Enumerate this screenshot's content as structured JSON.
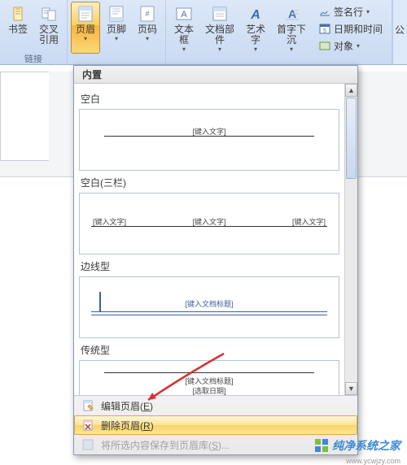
{
  "ribbon": {
    "groups": {
      "links": {
        "label": "链接",
        "items": {
          "bookmark": "书签",
          "crossref": "交叉\n引用"
        }
      },
      "headerfooter": {
        "items": {
          "header": "页眉",
          "footer": "页脚",
          "pagenum": "页码"
        }
      },
      "text": {
        "items": {
          "textbox": "文本框",
          "quickparts": "文档部件",
          "wordart": "艺术字",
          "dropcap": "首字下沉"
        }
      },
      "mini": {
        "signature": "签名行",
        "datetime": "日期和时间",
        "object": "对象"
      }
    },
    "public_fragment": "公"
  },
  "dropdown": {
    "header": "内置",
    "templates": [
      {
        "name": "空白",
        "fields": [
          "[键入文字]"
        ]
      },
      {
        "name": "空白(三栏)",
        "fields": [
          "[键入文字]",
          "[键入文字]",
          "[键入文字]"
        ]
      },
      {
        "name": "边线型",
        "fields": [
          "[键入文档标题]"
        ]
      },
      {
        "name": "传统型",
        "fields": [
          "[键入文档标题]",
          "[选取日期]"
        ]
      }
    ],
    "menu": {
      "edit": {
        "text": "编辑页眉",
        "hotkey": "E"
      },
      "remove": {
        "text": "删除页眉",
        "hotkey": "R"
      },
      "save": {
        "text": "将所选内容保存到页眉库",
        "hotkey": "S"
      }
    }
  },
  "watermark": {
    "text": "纯净系统之家",
    "url": "www.ycwjzy.com"
  }
}
